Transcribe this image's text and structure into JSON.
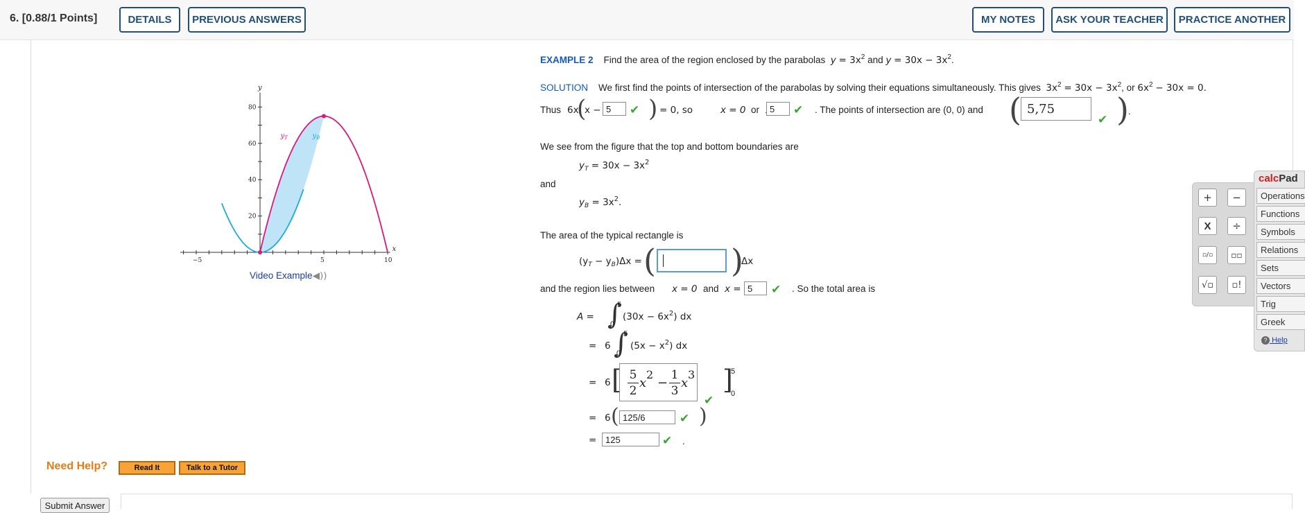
{
  "header": {
    "question": "6. [0.88/1 Points]",
    "details": "DETAILS",
    "previous_answers": "PREVIOUS ANSWERS",
    "my_notes": "MY NOTES",
    "ask_teacher": "ASK YOUR TEACHER",
    "practice_another": "PRACTICE ANOTHER"
  },
  "graph": {
    "y_axis": "y",
    "x_axis": "x",
    "y_ticks": [
      "80",
      "60",
      "40",
      "20"
    ],
    "x_ticks": [
      "−5",
      "5",
      "10"
    ],
    "label_top": "y",
    "label_top_sub": "T",
    "label_bottom": "y",
    "label_bottom_sub": "B",
    "curve_colors": {
      "parabola_up": "#1aabe0",
      "parabola_down": "#e0157a",
      "region_fill": "#bfe4f7"
    }
  },
  "video_link": "Video Example",
  "example": {
    "title": "EXAMPLE 2",
    "statement": "Find the area of the region enclosed by the parabolas",
    "eq1_lhs": "y",
    "eq1_rhs": "= 3x",
    "and": "and",
    "eq2_lhs": "y",
    "eq2_rhs": "= 30x − 3x",
    "period": "."
  },
  "solution": {
    "label": "SOLUTION",
    "text": "We first find the points of intersection of the parabolas by solving their equations simultaneously. This gives",
    "eq_a": "3x",
    "eq_b": "= 30x − 3x",
    "or": ",  or",
    "eq_c": "6x",
    "eq_d": "− 30x = 0.",
    "thus": "Thus",
    "factor_pre": "6x",
    "factor_x": "x −",
    "ans1": "5",
    "eq_zero": "= 0,  so",
    "x0": "x = 0",
    "or2": "or",
    "x_eq": "x =",
    "ans2": "5",
    "points_text": ". The points of intersection are (0, 0) and",
    "ans3": "5,75",
    "close_period": "."
  },
  "boundaries": {
    "intro": "We see from the figure that the top and bottom boundaries are",
    "yT": "y",
    "yT_sub": "T",
    "yT_rhs": "= 30x − 3x",
    "and": "and",
    "yB": "y",
    "yB_sub": "B",
    "yB_rhs": "= 3x",
    "yB_end": "."
  },
  "rectangle": {
    "intro": "The area of the typical rectangle is",
    "lhs": "(y",
    "lhs_t": "T",
    "lhs_mid": " − y",
    "lhs_b": "B",
    "lhs_end": ")Δx =",
    "input_value": "",
    "dx": "Δx"
  },
  "region": {
    "text": "and the region lies between",
    "x0": "x = 0",
    "and": "and",
    "x_eq": "x =",
    "ans": "5",
    "total": ". So the total area is"
  },
  "integral": {
    "A": "A =",
    "eq": "=",
    "six": "6",
    "upper": "5",
    "lower": "0",
    "int1": "(30x − 6x",
    "int1_end": ") dx",
    "int2": "(5x − x",
    "int2_end": ") dx",
    "frac1_num": "5",
    "frac1_den": "2",
    "x2": "x",
    "minus": "−",
    "frac2_num": "1",
    "frac2_den": "3",
    "x3": "x",
    "exp2": "2",
    "exp3": "3",
    "eval_upper": "5",
    "eval_lower": "0",
    "ans_fraction": "125/6",
    "ans_total": "125",
    "end_dot": "."
  },
  "calcpad": {
    "title_calc": "calc",
    "title_pad": "Pad",
    "tabs": [
      "Operations",
      "Functions",
      "Symbols",
      "Relations",
      "Sets",
      "Vectors",
      "Trig",
      "Greek"
    ],
    "help": "Help",
    "buttons": [
      "+",
      "−",
      "X",
      "÷",
      "▫/▫",
      "▫▫",
      "√▫",
      "▫!"
    ]
  },
  "help": {
    "label": "Need Help?",
    "read_it": "Read It",
    "talk_tutor": "Talk to a Tutor"
  },
  "submit": "Submit Answer"
}
